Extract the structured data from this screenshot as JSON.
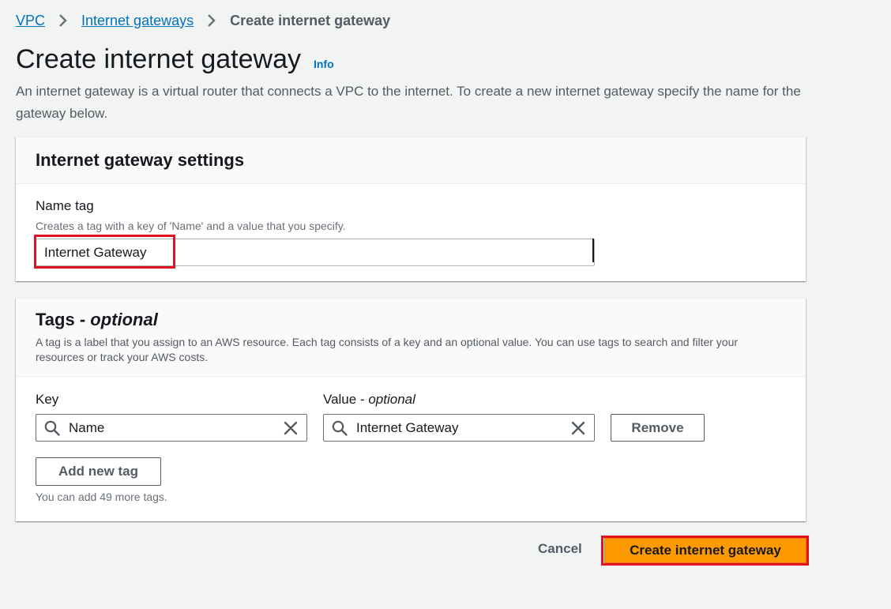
{
  "breadcrumb": {
    "items": [
      {
        "label": "VPC"
      },
      {
        "label": "Internet gateways"
      },
      {
        "label": "Create internet gateway"
      }
    ]
  },
  "page": {
    "title": "Create internet gateway",
    "info_label": "Info",
    "description": "An internet gateway is a virtual router that connects a VPC to the internet. To create a new internet gateway specify the name for the gateway below."
  },
  "settings_panel": {
    "title": "Internet gateway settings",
    "name_tag": {
      "label": "Name tag",
      "description": "Creates a tag with a key of 'Name' and a value that you specify.",
      "value": "Internet Gateway"
    }
  },
  "tags_panel": {
    "title": "Tags - ",
    "title_optional": "optional",
    "description": "A tag is a label that you assign to an AWS resource. Each tag consists of a key and an optional value. You can use tags to search and filter your resources or track your AWS costs.",
    "key_label": "Key",
    "value_label": "Value - ",
    "value_label_optional": "optional",
    "tags": [
      {
        "key": "Name",
        "value": "Internet Gateway"
      }
    ],
    "remove_label": "Remove",
    "add_label": "Add new tag",
    "help_text": "You can add 49 more tags."
  },
  "footer": {
    "cancel_label": "Cancel",
    "submit_label": "Create internet gateway"
  },
  "icons": {
    "breadcrumb_separator": "chevron-right-icon",
    "search": "search-icon",
    "clear": "close-icon"
  },
  "colors": {
    "link": "#0073bb",
    "primary": "#ff9900",
    "highlight": "#e0141e",
    "background": "#f2f3f3"
  }
}
